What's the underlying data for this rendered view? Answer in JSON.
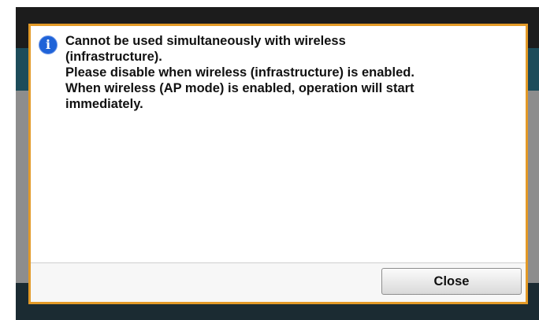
{
  "dialog": {
    "icon": "info-icon",
    "icon_glyph": "i",
    "message": "Cannot be used simultaneously with wireless\n(infrastructure).\nPlease disable when wireless (infrastructure) is enabled.\nWhen wireless (AP mode) is enabled, operation will start\nimmediately.",
    "close_label": "Close"
  },
  "colors": {
    "dialog_border": "#e39a27",
    "info_icon": "#1f63d8",
    "screen_background": "#1c1c1c",
    "header_bar": "#1d4c5a"
  }
}
